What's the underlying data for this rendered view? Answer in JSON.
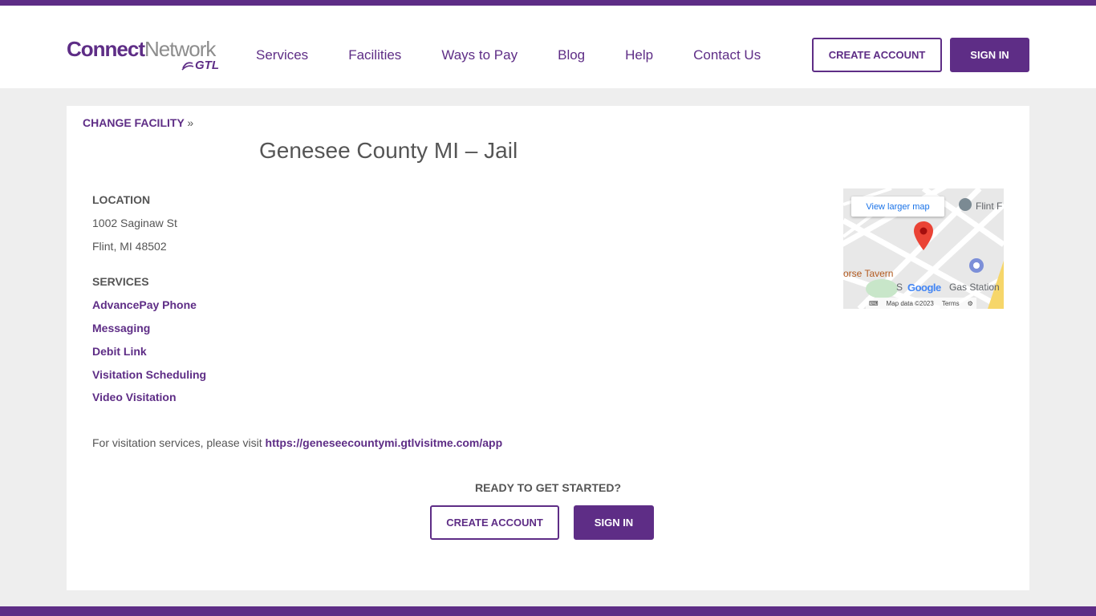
{
  "brand": {
    "logo_bold": "Connect",
    "logo_light": "Network",
    "logo_sub": "GTL"
  },
  "nav": {
    "items": [
      {
        "label": "Services"
      },
      {
        "label": "Facilities"
      },
      {
        "label": "Ways to Pay"
      },
      {
        "label": "Blog"
      },
      {
        "label": "Help"
      },
      {
        "label": "Contact Us"
      }
    ]
  },
  "header_actions": {
    "create_account": "CREATE ACCOUNT",
    "sign_in": "SIGN IN"
  },
  "facility": {
    "change_label": "CHANGE FACILITY",
    "change_suffix": "»",
    "name": "Genesee County MI – Jail",
    "location_label": "LOCATION",
    "address_line1": "1002 Saginaw St",
    "address_line2": "Flint, MI 48502",
    "services_label": "SERVICES",
    "services": [
      {
        "label": "AdvancePay Phone"
      },
      {
        "label": "Messaging"
      },
      {
        "label": "Debit Link"
      },
      {
        "label": "Visitation Scheduling"
      },
      {
        "label": "Video Visitation"
      }
    ],
    "visit_note": "For visitation services, please visit ",
    "visit_url": "https://geneseecountymi.gtlvisitme.com/app"
  },
  "map": {
    "view_larger": "View larger map",
    "label_flint": "Flint F",
    "label_tavern": "orse Tavern",
    "label_gas": "Gas Station",
    "label_s": "S",
    "google_word": "Google",
    "map_data": "Map data ©2023",
    "terms": "Terms",
    "pin_icon": "map-pin-icon"
  },
  "cta": {
    "heading": "READY TO GET STARTED?",
    "create_account": "CREATE ACCOUNT",
    "sign_in": "SIGN IN"
  },
  "colors": {
    "brand_purple": "#5e2d86",
    "page_bg": "#eeeeee",
    "text_gray": "#555555"
  }
}
